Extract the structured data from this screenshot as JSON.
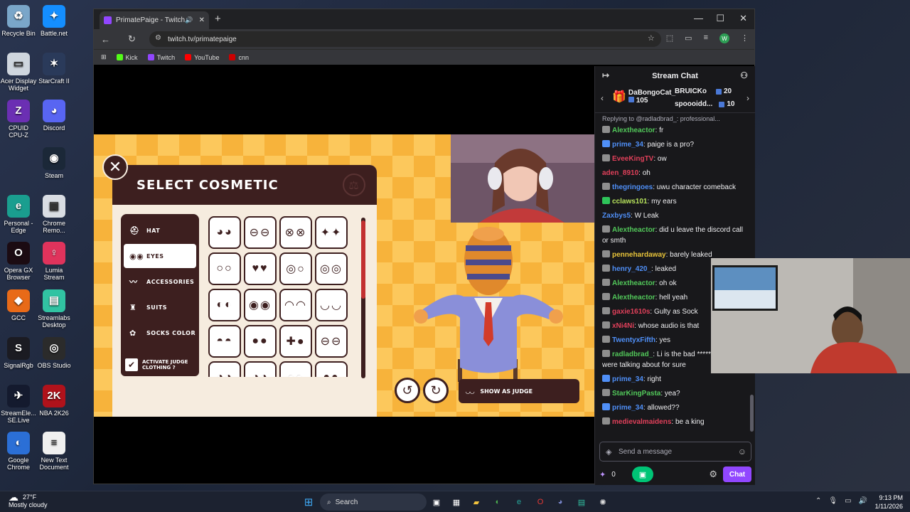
{
  "desktop": {
    "icons": [
      {
        "label": "Recycle Bin",
        "icon": "recycle-bin-icon",
        "color": "#7aa6c9",
        "glyph": "♻"
      },
      {
        "label": "Battle.net",
        "icon": "battlenet-icon",
        "color": "#148eff",
        "glyph": "✦"
      },
      {
        "label": "Acer Display Widget",
        "icon": "acer-display-icon",
        "color": "#cfd6de",
        "glyph": "▭"
      },
      {
        "label": "StarCraft II",
        "icon": "starcraft-icon",
        "color": "#2a3a5a",
        "glyph": "✶"
      },
      {
        "label": "CPUID CPU-Z",
        "icon": "cpuz-icon",
        "color": "#6b2fb3",
        "glyph": "Z"
      },
      {
        "label": "Discord",
        "icon": "discord-icon",
        "color": "#5865f2",
        "glyph": "◕"
      },
      {
        "label": "Steam",
        "icon": "steam-icon",
        "color": "#1b2838",
        "glyph": "◉"
      },
      {
        "label": "Personal - Edge",
        "icon": "edge-icon",
        "color": "#1a9e8f",
        "glyph": "e"
      },
      {
        "label": "Chrome Remo...",
        "icon": "chrome-remote-icon",
        "color": "#d9dde3",
        "glyph": "▣"
      },
      {
        "label": "Opera GX Browser",
        "icon": "opera-gx-icon",
        "color": "#1b0b12",
        "glyph": "O"
      },
      {
        "label": "Lumia Stream",
        "icon": "lumia-icon",
        "color": "#e0335c",
        "glyph": "♀"
      },
      {
        "label": "GCC",
        "icon": "gcc-icon",
        "color": "#e86a18",
        "glyph": "◆"
      },
      {
        "label": "Streamlabs Desktop",
        "icon": "streamlabs-icon",
        "color": "#31c3a2",
        "glyph": "▤"
      },
      {
        "label": "SignalRgb",
        "icon": "signalrgb-icon",
        "color": "#1b1b22",
        "glyph": "S"
      },
      {
        "label": "OBS Studio",
        "icon": "obs-icon",
        "color": "#2b2b2b",
        "glyph": "◎"
      },
      {
        "label": "StreamEle... SE.Live",
        "icon": "streamelements-icon",
        "color": "#141a2e",
        "glyph": "✈"
      },
      {
        "label": "NBA 2K26",
        "icon": "nba2k-icon",
        "color": "#b0121b",
        "glyph": "2K"
      },
      {
        "label": "Google Chrome",
        "icon": "chrome-icon",
        "color": "#2b6fd6",
        "glyph": "◐"
      },
      {
        "label": "New Text Document",
        "icon": "text-document-icon",
        "color": "#f0f0f0",
        "glyph": "≡"
      }
    ]
  },
  "browser": {
    "tab_title": "PrimatePaige - Twitch",
    "url": "twitch.tv/primatepaige",
    "profile_initial": "W",
    "bookmarks": [
      {
        "label": "Kick",
        "color": "#53fc18"
      },
      {
        "label": "Twitch",
        "color": "#9146ff"
      },
      {
        "label": "YouTube",
        "color": "#ff0000"
      },
      {
        "label": "cnn",
        "color": "#cc0000"
      }
    ]
  },
  "game": {
    "title": "SELECT COSMETIC",
    "categories": [
      {
        "label": "HAT",
        "icon": "hat-icon",
        "glyph": "⛑"
      },
      {
        "label": "EYES",
        "icon": "eyes-icon",
        "glyph": "◉◉"
      },
      {
        "label": "ACCESSORIES",
        "icon": "mustache-icon",
        "glyph": "〰"
      },
      {
        "label": "SUITS",
        "icon": "suit-icon",
        "glyph": "♜"
      },
      {
        "label": "SOCKS COLOR",
        "icon": "palette-icon",
        "glyph": "✿"
      }
    ],
    "judge_toggle": "ACTIVATE JUDGE CLOTHING ?",
    "show_as_judge": "SHOW AS JUDGE"
  },
  "chat": {
    "title": "Stream Chat",
    "gifts": [
      {
        "name": "DaBongoCat_",
        "count": "105"
      },
      {
        "name": "BRUICKo",
        "count": "20"
      },
      {
        "name": "spoooidd...",
        "count": "10"
      }
    ],
    "reply_context": "Replying to @radladbrad_: professional...",
    "messages": [
      {
        "user": "Alextheactor",
        "text": "fr",
        "color": "#52c85a",
        "badge": "#8e8e8e"
      },
      {
        "user": "prime_34",
        "text": "paige is a pro?",
        "color": "#4f8ff7",
        "badge": "#4f8ff7"
      },
      {
        "user": "EveeKingTV",
        "text": "ow",
        "color": "#e0405a",
        "badge": "#8e8e8e"
      },
      {
        "user": "aden_8910",
        "text": "oh",
        "color": "#e0405a",
        "badge": ""
      },
      {
        "user": "thegringoes",
        "text": "uwu character comeback",
        "color": "#4f8ff7",
        "badge": "#8e8e8e"
      },
      {
        "user": "cclaws101",
        "text": "my ears",
        "color": "#b7e35c",
        "badge": "#2ec45a"
      },
      {
        "user": "Zaxbys5",
        "text": "W Leak",
        "color": "#4f8ff7",
        "badge": ""
      },
      {
        "user": "Alextheactor",
        "text": "did u leave the discord call or smth",
        "color": "#52c85a",
        "badge": "#8e8e8e"
      },
      {
        "user": "pennehardaway",
        "text": "barely leaked",
        "color": "#e8c43a",
        "badge": "#8e8e8e"
      },
      {
        "user": "henry_420_",
        "text": "leaked",
        "color": "#4f8ff7",
        "badge": "#8e8e8e"
      },
      {
        "user": "Alextheactor",
        "text": "oh ok",
        "color": "#52c85a",
        "badge": "#8e8e8e"
      },
      {
        "user": "Alextheactor",
        "text": "hell yeah",
        "color": "#52c85a",
        "badge": "#8e8e8e"
      },
      {
        "user": "gaxie1610s",
        "text": "Gulty as Sock",
        "color": "#e0405a",
        "badge": "#8e8e8e"
      },
      {
        "user": "xNi4Ni",
        "text": "whose audio is that",
        "color": "#e0405a",
        "badge": "#8e8e8e"
      },
      {
        "user": "TwentyxFifth",
        "text": "yes",
        "color": "#4f8ff7",
        "badge": "#8e8e8e"
      },
      {
        "user": "radladbrad_",
        "text": "Li is the bad ***** and Paige were talking about for sure",
        "color": "#52c85a",
        "badge": "#8e8e8e"
      },
      {
        "user": "prime_34",
        "text": "right",
        "color": "#4f8ff7",
        "badge": "#4f8ff7"
      },
      {
        "user": "StarKingPasta",
        "text": "yea?",
        "color": "#52c85a",
        "badge": "#8e8e8e"
      },
      {
        "user": "prime_34",
        "text": "allowed??",
        "color": "#4f8ff7",
        "badge": "#4f8ff7"
      },
      {
        "user": "medievalmaidens",
        "text": "be a king",
        "color": "#e0405a",
        "badge": "#8e8e8e"
      }
    ],
    "input_placeholder": "Send a message",
    "points": "0",
    "send_label": "Chat"
  },
  "taskbar": {
    "temperature": "27°F",
    "weather": "Mostly cloudy",
    "search_label": "Search",
    "time": "9:13 PM",
    "date": "1/11/2026"
  }
}
